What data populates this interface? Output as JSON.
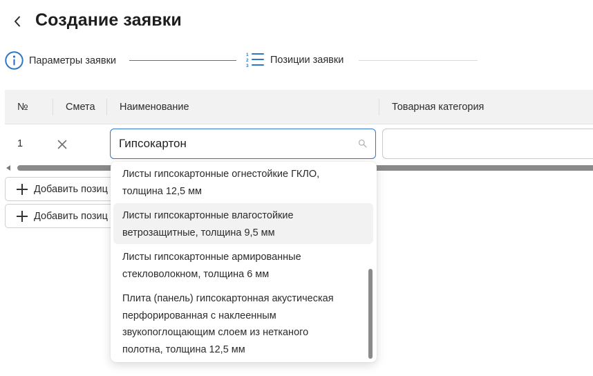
{
  "header": {
    "title": "Создание заявки",
    "back_icon": "chevron-left-icon"
  },
  "stepper": {
    "steps": [
      {
        "label": "Параметры заявки",
        "icon": "info-icon",
        "state": "done"
      },
      {
        "label": "Позиции заявки",
        "icon": "numbered-list-icon",
        "state": "active"
      }
    ]
  },
  "table": {
    "columns": [
      "№",
      "Смета",
      "Наименование",
      "Товарная категория"
    ],
    "rows": [
      {
        "num": "1",
        "name_value": "Гипсокартон",
        "category_value": ""
      }
    ]
  },
  "actions": {
    "add_buttons": [
      {
        "label": "Добавить позиц"
      },
      {
        "label": "Добавить позиц"
      }
    ]
  },
  "dropdown": {
    "options": [
      {
        "line1": "Листы гипсокартонные огнестойкие ГКЛО,",
        "line2": "толщина 12,5 мм"
      },
      {
        "line1": "Листы гипсокартонные влагостойкие",
        "line2": "ветрозащитные, толщина 9,5 мм"
      },
      {
        "line1": "Листы гипсокартонные армированные",
        "line2": "стекловолокном, толщина 6 мм"
      },
      {
        "line1": "Плита (панель) гипсокартонная акустическая",
        "line2": "перфорированная с наклеенным",
        "line3": "звукопоглощающим слоем из нетканого",
        "line4": "полотна, толщина 12,5 мм"
      }
    ],
    "highlighted_index": 1
  },
  "colors": {
    "accent": "#2e76c8",
    "header_bg": "#f2f2f2",
    "scroll_thumb": "#8a8a8a"
  }
}
